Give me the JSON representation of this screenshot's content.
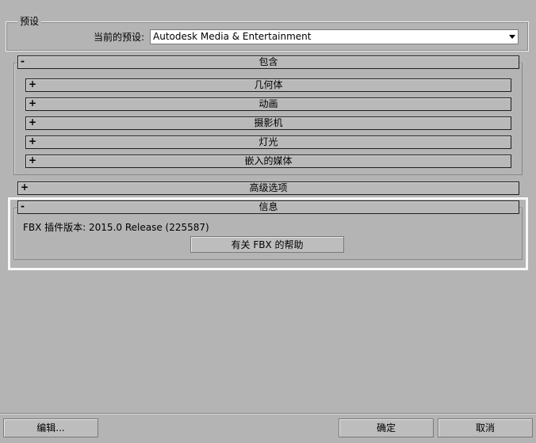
{
  "preset": {
    "legend": "预设",
    "current_label": "当前的预设:",
    "current_value": "Autodesk Media & Entertainment"
  },
  "include": {
    "sign": "-",
    "title": "包含",
    "items": [
      {
        "sign": "+",
        "label": "几何体"
      },
      {
        "sign": "+",
        "label": "动画"
      },
      {
        "sign": "+",
        "label": "摄影机"
      },
      {
        "sign": "+",
        "label": "灯光"
      },
      {
        "sign": "+",
        "label": "嵌入的媒体"
      }
    ]
  },
  "advanced": {
    "sign": "+",
    "title": "高级选项"
  },
  "info": {
    "sign": "-",
    "title": "信息",
    "version_text": "FBX 插件版本: 2015.0 Release (225587)",
    "help_button": "有关 FBX 的帮助"
  },
  "footer": {
    "edit_button": "编辑...",
    "ok_button": "确定",
    "cancel_button": "取消"
  }
}
